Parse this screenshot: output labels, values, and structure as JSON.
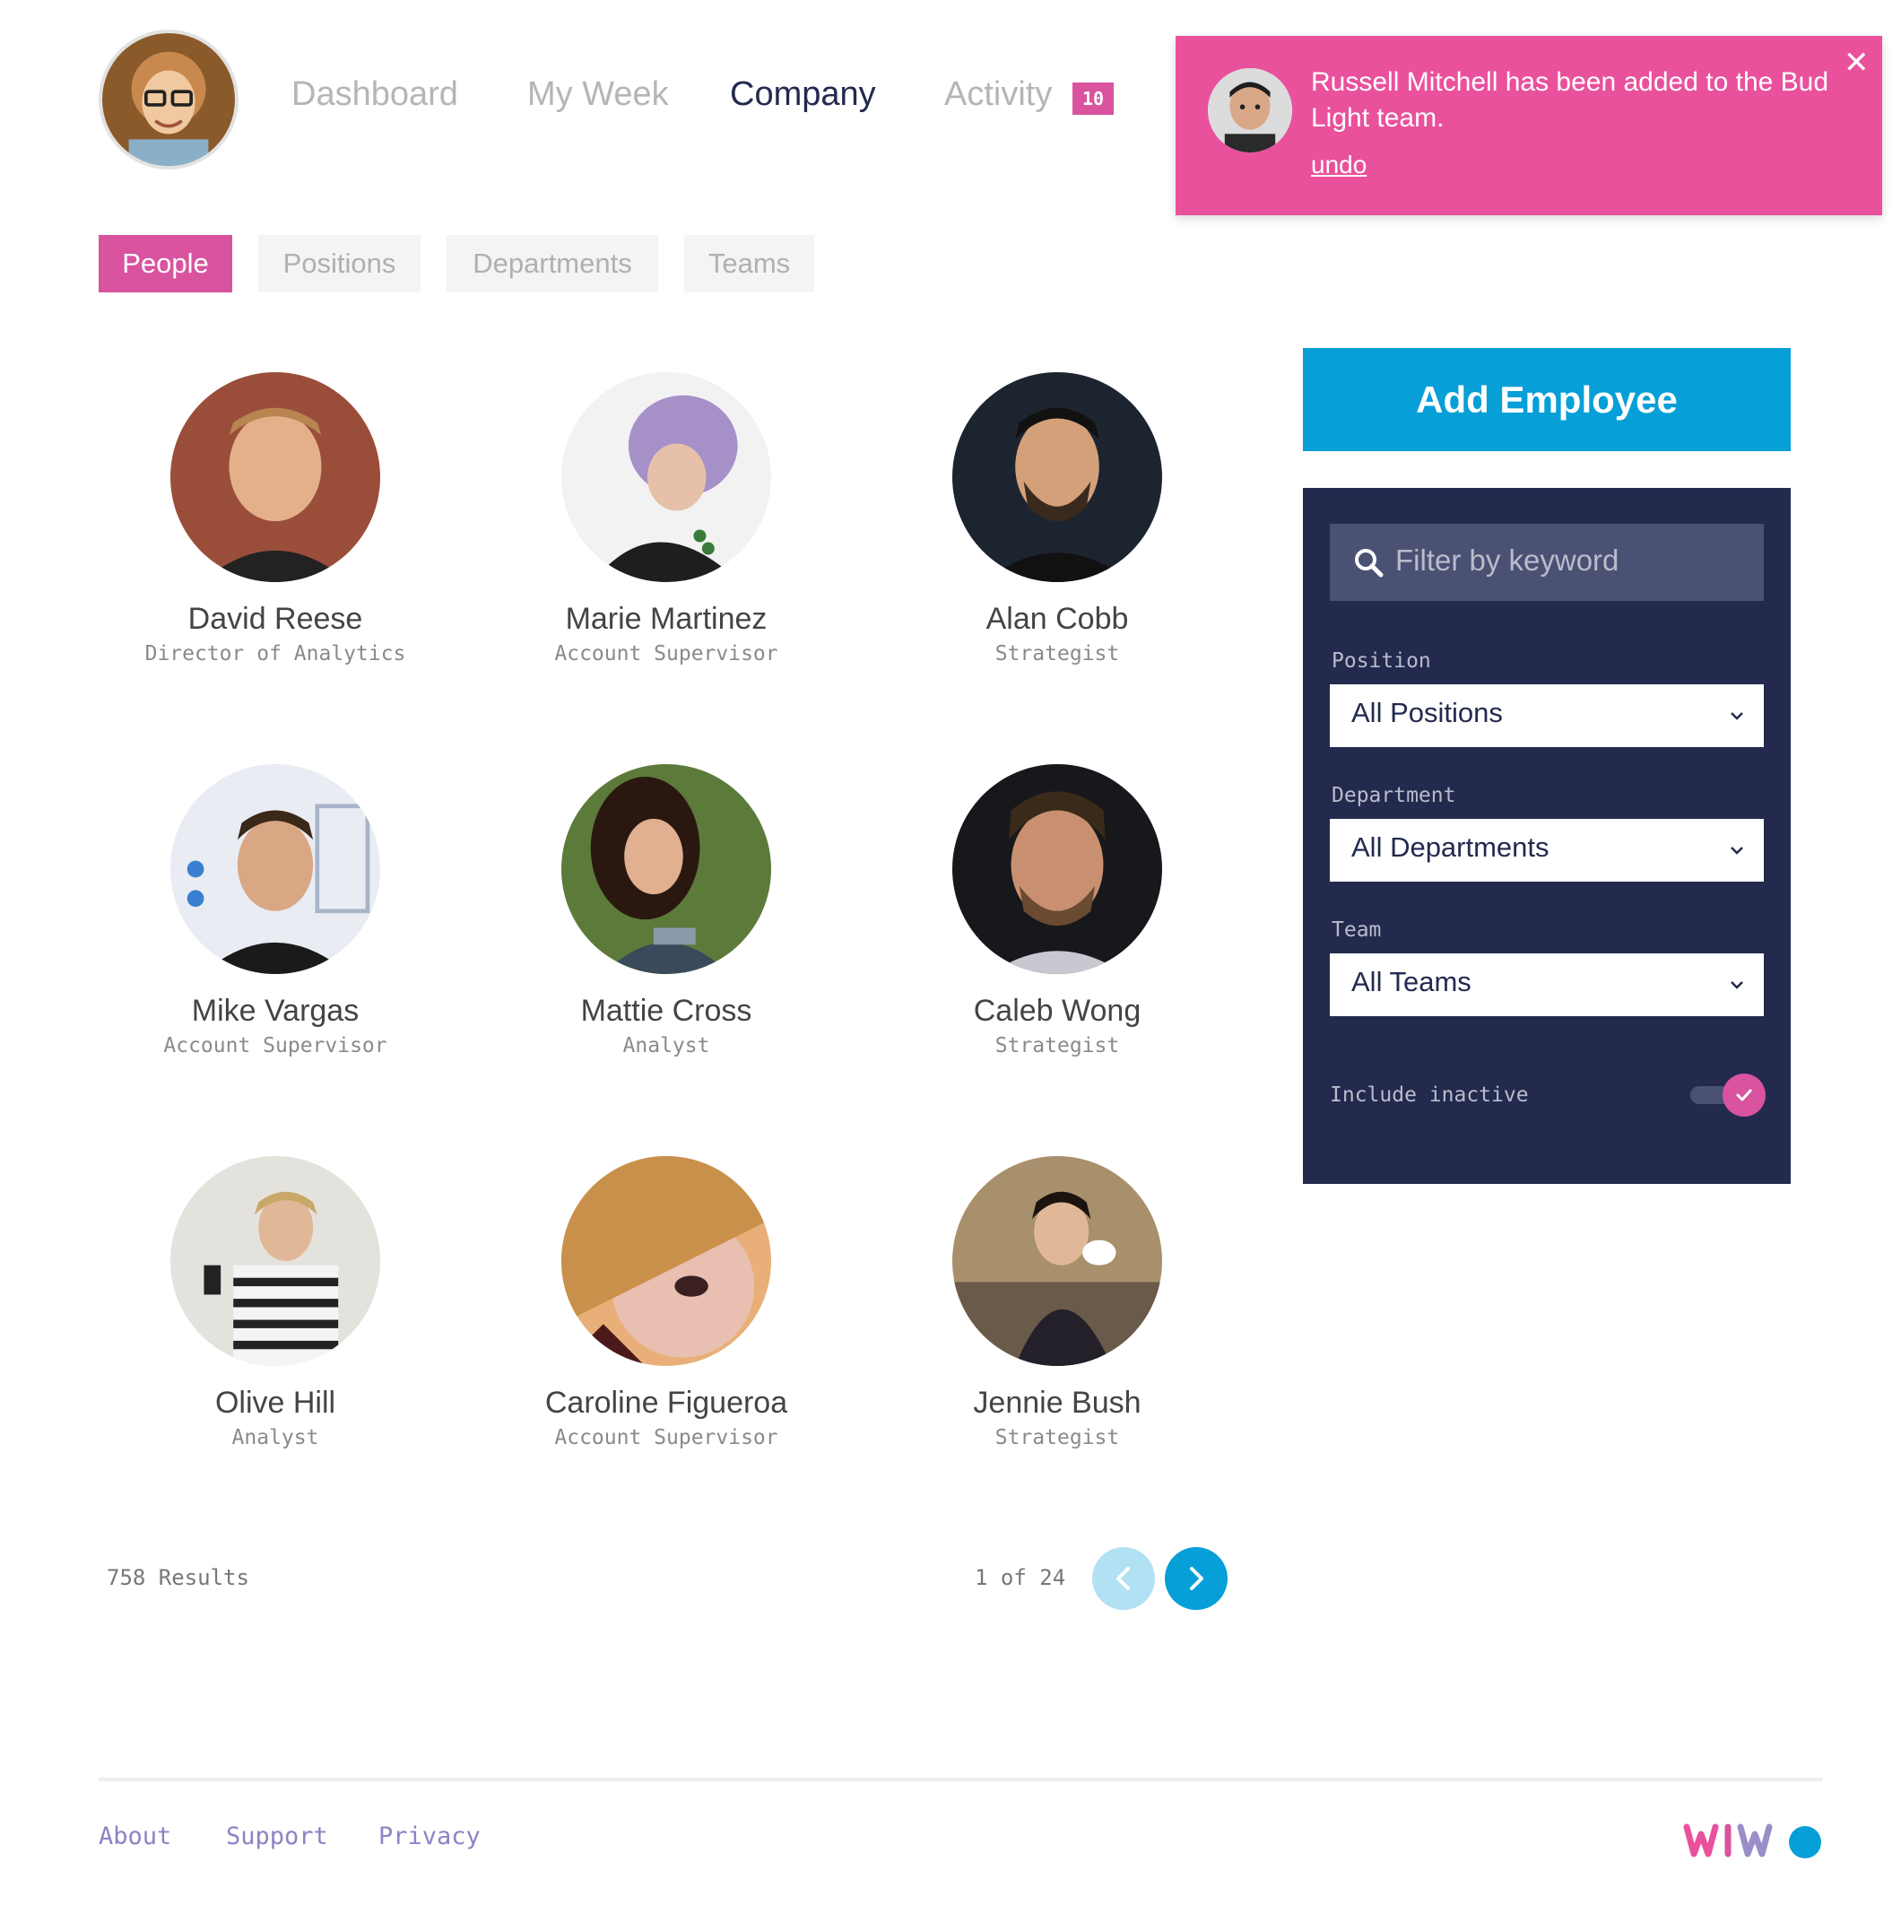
{
  "nav": {
    "items": [
      {
        "label": "Dashboard",
        "active": false
      },
      {
        "label": "My Week",
        "active": false
      },
      {
        "label": "Company",
        "active": true
      },
      {
        "label": "Activity",
        "active": false
      }
    ],
    "activity_count": "10"
  },
  "toast": {
    "message": "Russell Mitchell has been added to the Bud Light team.",
    "undo_label": "undo",
    "close_label": "✕"
  },
  "tabs": [
    {
      "label": "People",
      "active": true
    },
    {
      "label": "Positions",
      "active": false
    },
    {
      "label": "Departments",
      "active": false
    },
    {
      "label": "Teams",
      "active": false
    }
  ],
  "people": [
    {
      "name": "David Reese",
      "role": "Director of Analytics"
    },
    {
      "name": "Marie Martinez",
      "role": "Account Supervisor"
    },
    {
      "name": "Alan Cobb",
      "role": "Strategist"
    },
    {
      "name": "Mike Vargas",
      "role": "Account Supervisor"
    },
    {
      "name": "Mattie Cross",
      "role": "Analyst"
    },
    {
      "name": "Caleb Wong",
      "role": "Strategist"
    },
    {
      "name": "Olive Hill",
      "role": "Analyst"
    },
    {
      "name": "Caroline Figueroa",
      "role": "Account Supervisor"
    },
    {
      "name": "Jennie Bush",
      "role": "Strategist"
    }
  ],
  "pagination": {
    "results": "758 Results",
    "page_info": "1 of 24"
  },
  "sidebar": {
    "add_button": "Add Employee",
    "search_placeholder": "Filter by keyword",
    "position_label": "Position",
    "position_value": "All Positions",
    "department_label": "Department",
    "department_value": "All Departments",
    "team_label": "Team",
    "team_value": "All Teams",
    "include_inactive_label": "Include inactive",
    "include_inactive": true
  },
  "footer": {
    "links": [
      "About",
      "Support",
      "Privacy"
    ],
    "logo_text": "WIWO"
  },
  "colors": {
    "accent_pink": "#d9539f",
    "toast_pink": "#e9519d",
    "accent_blue": "#069fd8",
    "navy": "#232a4e"
  }
}
